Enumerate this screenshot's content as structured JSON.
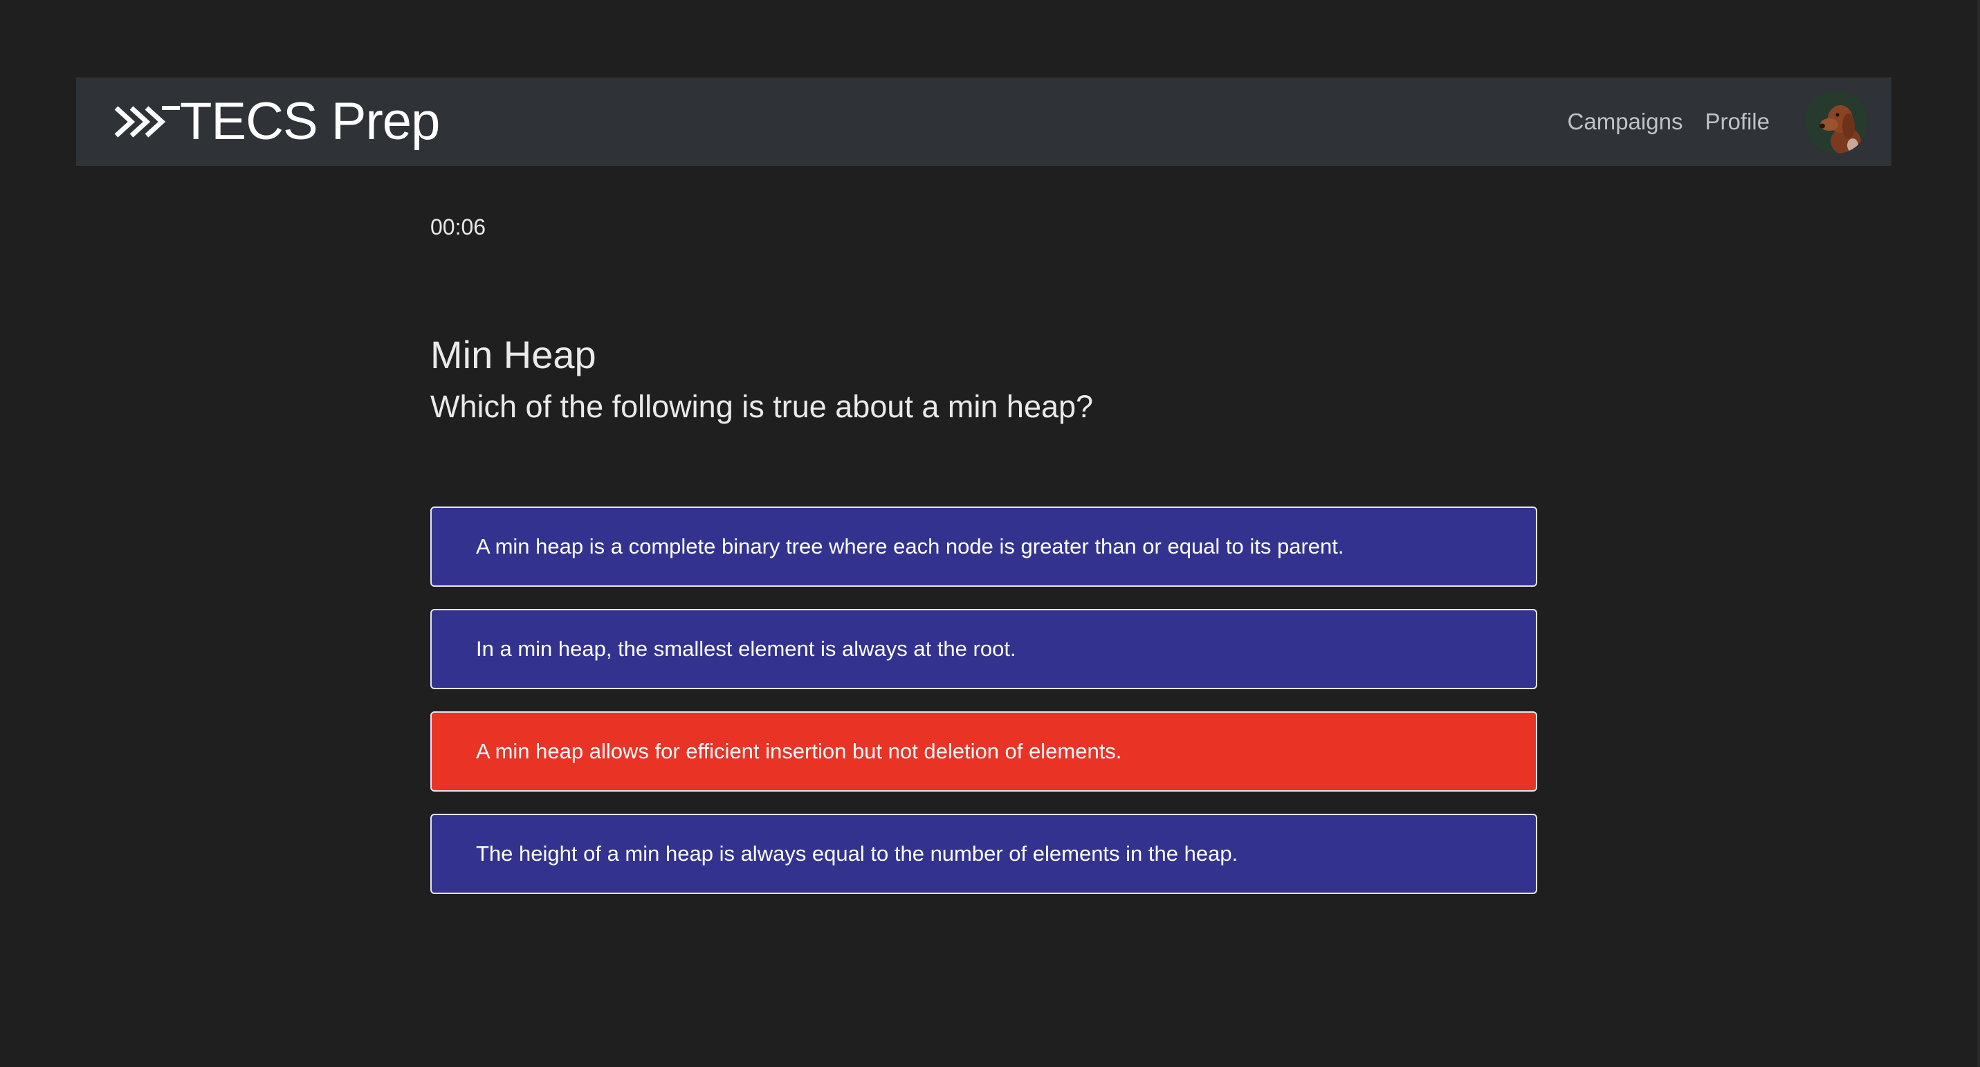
{
  "header": {
    "brand_name": "TECS Prep",
    "nav_links": [
      "Campaigns",
      "Profile"
    ],
    "avatar_icon": "dog-avatar-icon"
  },
  "quiz": {
    "timer": "00:06",
    "title": "Min Heap",
    "question": "Which of the following is true about a min heap?",
    "options": [
      {
        "text": "A min heap is a complete binary tree where each node is greater than or equal to its parent.",
        "state": "default"
      },
      {
        "text": "In a min heap, the smallest element is always at the root.",
        "state": "default"
      },
      {
        "text": "A min heap allows for efficient insertion but not deletion of elements.",
        "state": "incorrect"
      },
      {
        "text": "The height of a min heap is always equal to the number of elements in the heap.",
        "state": "default"
      }
    ]
  },
  "colors": {
    "background": "#1f1f1f",
    "navbar": "#2f3236",
    "option_default": "#33338f",
    "option_incorrect": "#e93325"
  }
}
